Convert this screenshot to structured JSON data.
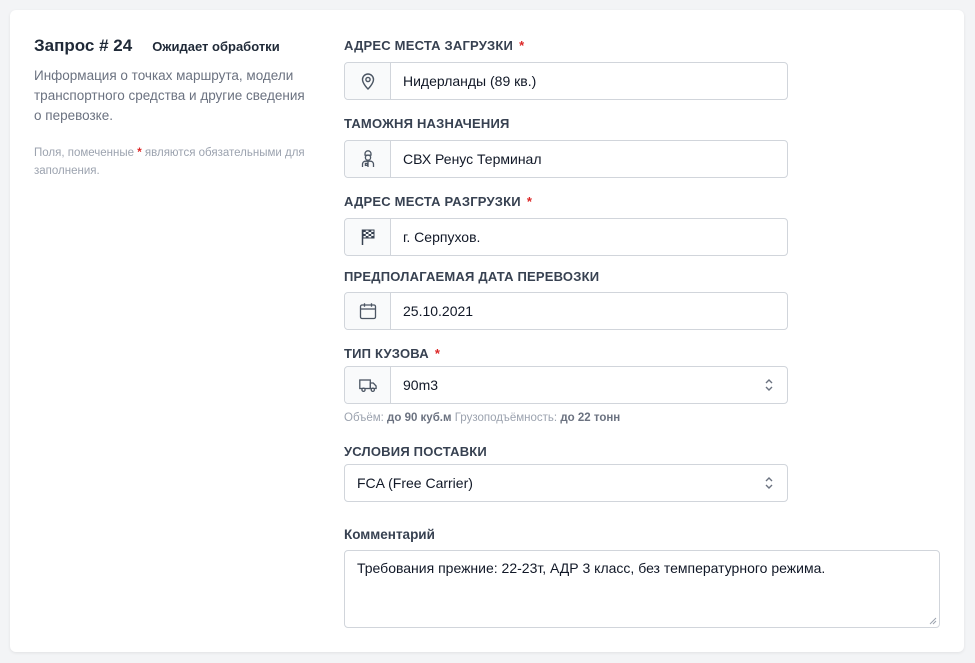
{
  "request": {
    "title": "Запрос # 24",
    "status": "Ожидает обработки",
    "description": "Информация о точках маршрута, модели транспортного средства и другие сведения о перевозке.",
    "note_prefix": "Поля, помеченные",
    "note_star": "*",
    "note_suffix": "являются обязательными для заполнения."
  },
  "fields": {
    "loading": {
      "label": "АДРЕС МЕСТА ЗАГРУЗКИ",
      "required": "*",
      "value": "Нидерланды (89 кв.)",
      "icon": "location-pin-icon"
    },
    "customs": {
      "label": "ТАМОЖНЯ НАЗНАЧЕНИЯ",
      "value": "СВХ Ренус Терминал",
      "icon": "customs-officer-icon"
    },
    "unloading": {
      "label": "АДРЕС МЕСТА РАЗГРУЗКИ",
      "required": "*",
      "value": "г. Серпухов.",
      "icon": "checkered-flag-icon"
    },
    "date": {
      "label": "ПРЕДПОЛАГАЕМАЯ ДАТА ПЕРЕВОЗКИ",
      "value": "25.10.2021",
      "icon": "calendar-icon"
    },
    "body_type": {
      "label": "ТИП КУЗОВА",
      "required": "*",
      "value": "90m3",
      "icon": "truck-icon"
    },
    "delivery": {
      "label": "УСЛОВИЯ ПОСТАВКИ",
      "value": "FCA (Free Carrier)"
    }
  },
  "hint": {
    "volume_label": "Объём:",
    "volume_value": "до 90 куб.м",
    "capacity_label": "Грузоподъёмность:",
    "capacity_value": "до 22 тонн"
  },
  "comment": {
    "label": "Комментарий",
    "value": "Требования прежние: 22-23т, АДР 3 класс, без температурного режима."
  }
}
